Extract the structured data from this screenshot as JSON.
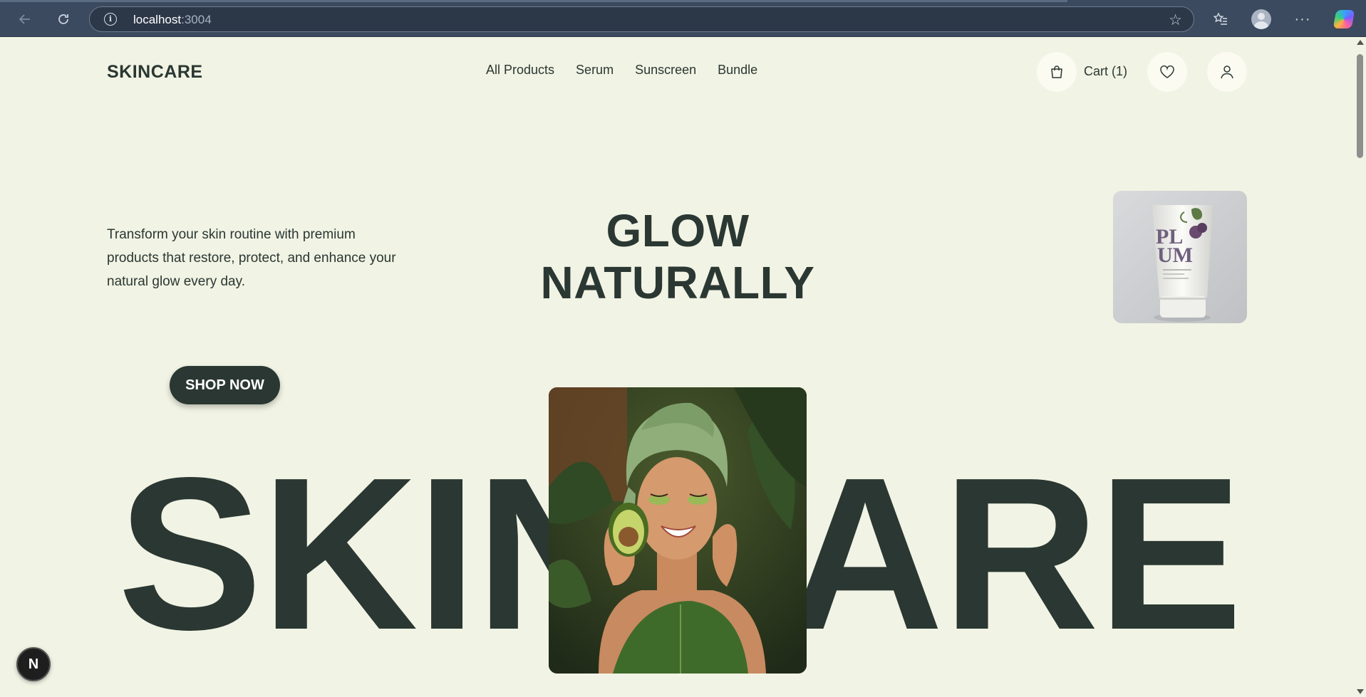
{
  "browser": {
    "url_host": "localhost",
    "url_port": ":3004"
  },
  "header": {
    "logo": "SKINCARE",
    "nav": [
      "All Products",
      "Serum",
      "Sunscreen",
      "Bundle"
    ],
    "cart_label": "Cart (1)"
  },
  "hero": {
    "description": "Transform your skin routine with premium products that restore, protect, and enhance your natural glow every day.",
    "title_line1": "GLOW",
    "title_line2": "NATURALLY",
    "cta": "SHOP NOW",
    "big_word": "SKINCARE",
    "product_label_line1": "PL",
    "product_label_line2": "UM"
  },
  "colors": {
    "background": "#f1f3e4",
    "primary_dark": "#2a3732",
    "icon_bg": "#fbfbf1"
  },
  "dev_badge": "N"
}
